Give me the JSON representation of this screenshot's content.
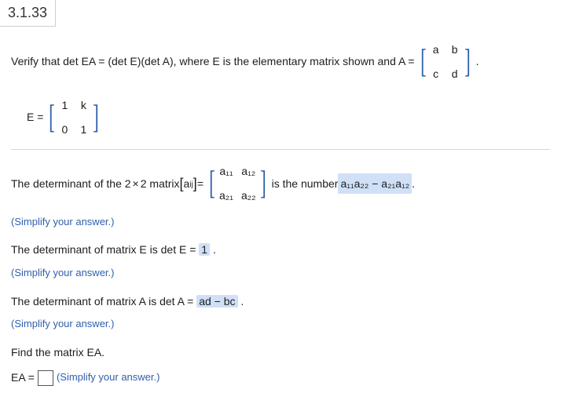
{
  "question_number": "3.1.33",
  "intro": {
    "text": "Verify that det EA = (det E)(det A), where E is the elementary matrix shown and A =",
    "period": "."
  },
  "matrix_A": {
    "a11": "a",
    "a12": "b",
    "a21": "c",
    "a22": "d"
  },
  "matrix_E_label": "E =",
  "matrix_E": {
    "a11": "1",
    "a12": "k",
    "a21": "0",
    "a22": "1"
  },
  "det_sentence": {
    "part1": "The determinant of the 2",
    "times": "×",
    "part2": "2 matrix ",
    "aij_open": "[",
    "aij_label_a": "a",
    "aij_label_ij": "ij",
    "aij_close": "]",
    "eq": " = ",
    "part3": " is the number ",
    "answer": "a₁₁a₂₂ − a₂₁a₁₂",
    "period": " ."
  },
  "matrix_generic": {
    "a11": "a₁₁",
    "a12": "a₁₂",
    "a21": "a₂₁",
    "a22": "a₂₂"
  },
  "simplify_note": "(Simplify your answer.)",
  "detE_sentence": {
    "part1": "The determinant of matrix E is det E = ",
    "answer": "1",
    "period": " ."
  },
  "detA_sentence": {
    "part1": "The determinant of matrix A is det A = ",
    "answer": "ad − bc",
    "period": " ."
  },
  "find_EA": "Find the matrix EA.",
  "EA_prompt": {
    "label": "EA =",
    "note": "(Simplify your answer.)"
  }
}
